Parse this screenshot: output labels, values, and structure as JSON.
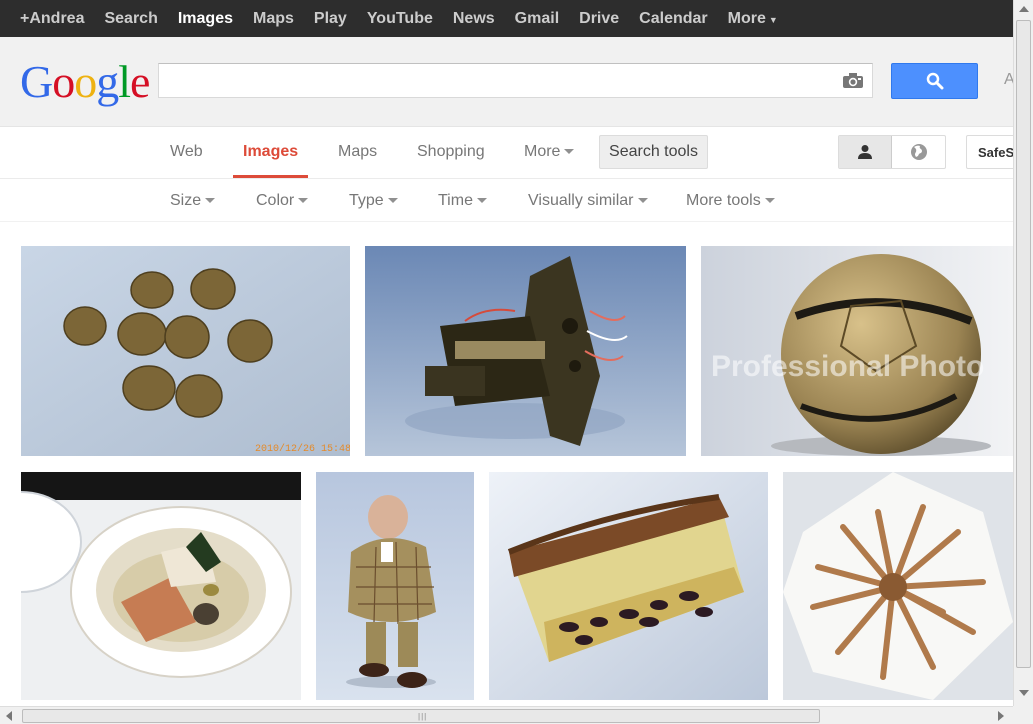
{
  "topbar": {
    "items": [
      "+Andrea",
      "Search",
      "Images",
      "Maps",
      "Play",
      "YouTube",
      "News",
      "Gmail",
      "Drive",
      "Calendar",
      "More"
    ],
    "active": "Images"
  },
  "header": {
    "logo": "Google",
    "search_value": "",
    "camera_icon": "camera-icon",
    "search_icon": "magnifier-icon",
    "truncated_text": "A",
    "search_button_color": "#4d90fe"
  },
  "nav": {
    "tabs": [
      "Web",
      "Images",
      "Maps",
      "Shopping",
      "More"
    ],
    "active": "Images",
    "search_tools": "Search tools",
    "safe_search": "SafeS",
    "accent_color": "#dd4b39"
  },
  "tools": [
    "Size",
    "Color",
    "Type",
    "Time",
    "Visually similar",
    "More tools"
  ],
  "results": {
    "images": [
      {
        "subject": "dried brown balls on blue background",
        "stamp": "2010/12/26 15:48"
      },
      {
        "subject": "mechanical part with wires"
      },
      {
        "subject": "gold soccer ball",
        "watermark": "Professional Photo"
      },
      {
        "subject": "bowl of fish stew"
      },
      {
        "subject": "figurine of man in checkered suit"
      },
      {
        "subject": "slice of fruit cake"
      },
      {
        "subject": "cordyceps fungus on white cloth"
      }
    ]
  }
}
